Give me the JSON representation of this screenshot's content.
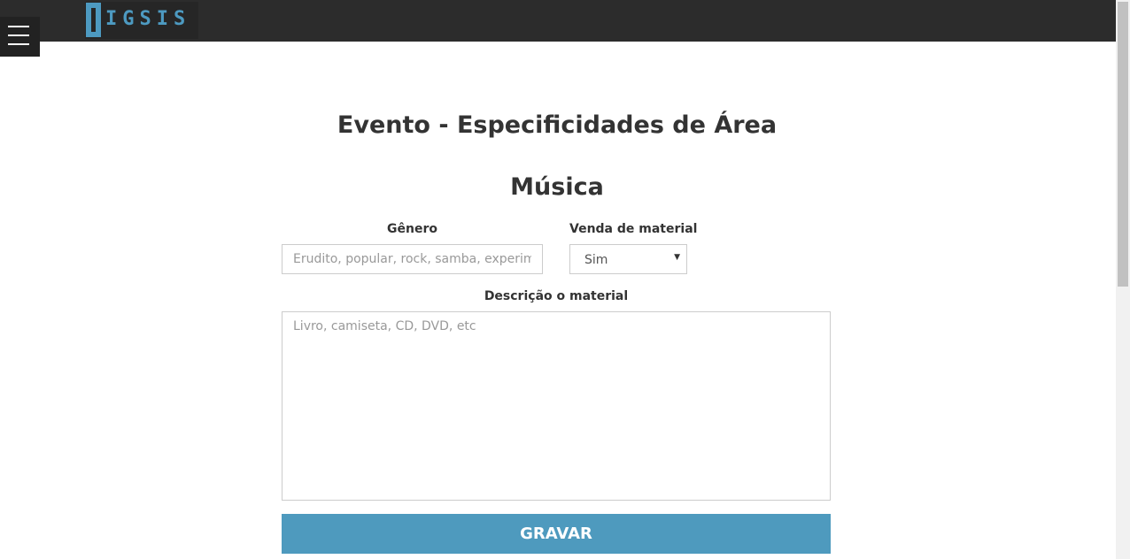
{
  "header": {
    "logo_text": "IGSIS",
    "menu_icon": "hamburger-icon"
  },
  "main": {
    "page_title": "Evento - Especificidades de Área",
    "section_title": "Música"
  },
  "form": {
    "genero": {
      "label": "Gênero",
      "value": "",
      "placeholder": "Erudito, popular, rock, samba, experimental"
    },
    "venda": {
      "label": "Venda de material",
      "selected": "Sim",
      "dropdown_icon": "chevron-down-icon"
    },
    "descricao": {
      "label": "Descrição o material",
      "value": "",
      "placeholder": "Livro, camiseta, CD, DVD, etc"
    },
    "submit_label": "GRAVAR"
  },
  "colors": {
    "topbar": "#2c2c2c",
    "accent": "#4e9abe",
    "text": "#333333"
  }
}
